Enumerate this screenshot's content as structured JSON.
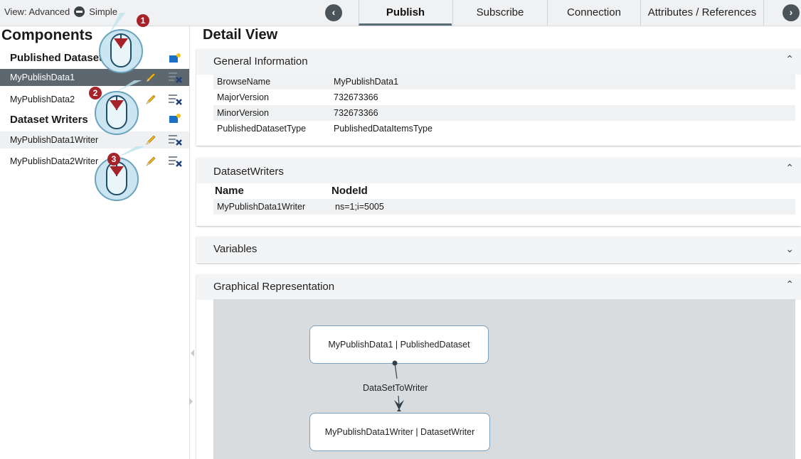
{
  "topbar": {
    "view_label": "View: Advanced",
    "simple_label": "Simple",
    "tabs": [
      {
        "label": "Publish"
      },
      {
        "label": "Subscribe"
      },
      {
        "label": "Connection"
      },
      {
        "label": "Attributes / References"
      }
    ]
  },
  "components": {
    "title": "Components",
    "published_datasets_title": "Published Datasets",
    "dataset_writers_title": "Dataset Writers",
    "datasets": [
      "MyPublishData1",
      "MyPublishData2"
    ],
    "writers": [
      "MyPublishData1Writer",
      "MyPublishData2Writer"
    ]
  },
  "detail": {
    "title": "Detail View",
    "general": {
      "title": "General Information",
      "rows": [
        {
          "key": "BrowseName",
          "value": "MyPublishData1"
        },
        {
          "key": "MajorVersion",
          "value": "732673366"
        },
        {
          "key": "MinorVersion",
          "value": "732673366"
        },
        {
          "key": "PublishedDatasetType",
          "value": "PublishedDataItemsType"
        }
      ]
    },
    "writers": {
      "title": "DatasetWriters",
      "col_name": "Name",
      "col_nodeid": "NodeId",
      "rows": [
        {
          "name": "MyPublishData1Writer",
          "nodeid": "ns=1;i=5005"
        }
      ]
    },
    "variables": {
      "title": "Variables"
    },
    "graph": {
      "title": "Graphical Representation",
      "node1": "MyPublishData1 | PublishedDataset",
      "edge": "DataSetToWriter",
      "node2": "MyPublishData1Writer | DatasetWriter"
    }
  },
  "callouts": [
    "1",
    "2",
    "3"
  ],
  "colors": {
    "selected_row": "#5c6770",
    "accent": "#5a6c78",
    "callout": "#a6232a"
  }
}
